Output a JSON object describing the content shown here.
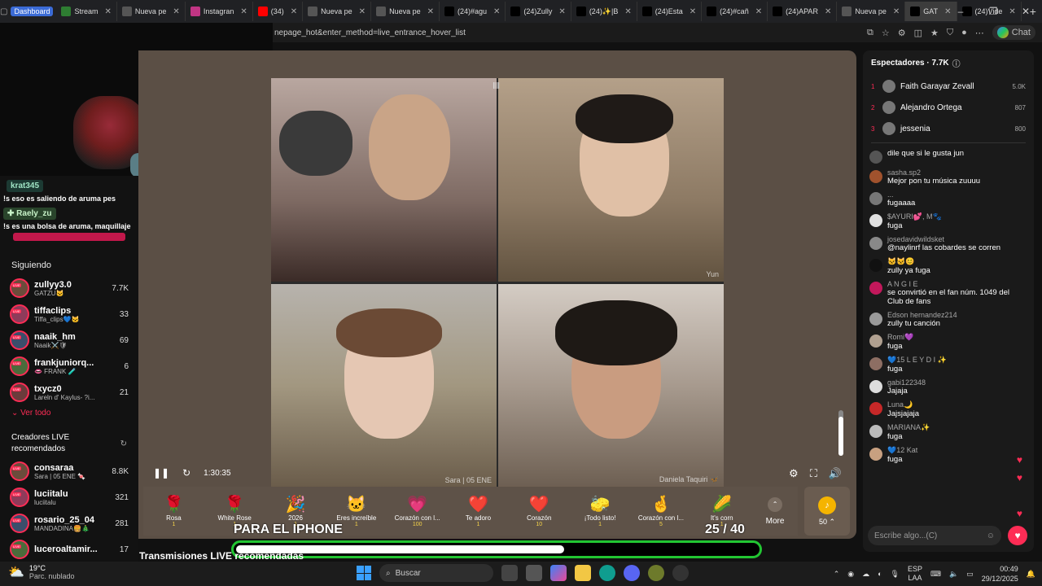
{
  "browser": {
    "tab_group": "Dashboard",
    "tabs": [
      {
        "label": "Stream",
        "color": "#2e7d32"
      },
      {
        "label": "Nueva pe",
        "color": "#555555"
      },
      {
        "label": "Instagran",
        "color": "#c13584"
      },
      {
        "label": "(34)",
        "color": "#ff0000"
      },
      {
        "label": "Nueva pe",
        "color": "#555555"
      },
      {
        "label": "Nueva pe",
        "color": "#555555"
      },
      {
        "label": "(24)#agu",
        "color": "#000000"
      },
      {
        "label": "(24)Zully",
        "color": "#000000"
      },
      {
        "label": "(24)✨|B",
        "color": "#000000"
      },
      {
        "label": "(24)Esta",
        "color": "#000000"
      },
      {
        "label": "(24)#cañ",
        "color": "#000000"
      },
      {
        "label": "(24)APAR",
        "color": "#000000"
      },
      {
        "label": "Nueva pe",
        "color": "#555555"
      },
      {
        "label": "GAT",
        "color": "#000000"
      },
      {
        "label": "(24)Vide",
        "color": "#000000"
      }
    ],
    "url": "nepage_hot&enter_method=live_entrance_hover_list",
    "chat_label": "Chat"
  },
  "overlay": {
    "user1": "krat345",
    "msg1": "!s eso es saliendo de aruma pes",
    "user2": "✚ Raely_zu",
    "msg2": "!s es una bolsa de aruma, maquillaje"
  },
  "sidebar": {
    "following_title": "Siguiendo",
    "following": [
      {
        "name": "zullyy3.0",
        "sub": "GATZU🐱",
        "count": "7.7K"
      },
      {
        "name": "tiffaclips",
        "sub": "Tiffa_clips💙🐱",
        "count": "33"
      },
      {
        "name": "naaik_hm",
        "sub": "Naaik⚔️🛡",
        "count": "69"
      },
      {
        "name": "frankjuniorq...",
        "sub": "👄 FRANK 🧪",
        "count": "6"
      },
      {
        "name": "txycz0",
        "sub": "Lareln d' Kaylus- ?i...",
        "count": "21"
      }
    ],
    "see_all": "Ver todo",
    "recommended_title": "Creadores LIVE recomendados",
    "recommended": [
      {
        "name": "consaraa",
        "sub": "Sara | 05 ENE 🍬",
        "count": "8.8K"
      },
      {
        "name": "luciitalu",
        "sub": "luciitalu",
        "count": "321"
      },
      {
        "name": "rosario_25_04",
        "sub": "MANDADINA🍔🎄",
        "count": "281"
      },
      {
        "name": "luceroaltamir...",
        "sub": "",
        "count": "17"
      }
    ]
  },
  "stage": {
    "time": "1:30:35",
    "cell_labels": [
      "",
      "Yun",
      "Sara | 05 ENE",
      "Daniela Taquiri 🦋"
    ],
    "volume_level": 0.85,
    "gifts": [
      {
        "icon": "🌹",
        "name": "Rosa",
        "price": "1"
      },
      {
        "icon": "🌹",
        "name": "White Rose",
        "price": "1"
      },
      {
        "icon": "🎉",
        "name": "2026",
        "price": "1"
      },
      {
        "icon": "🐱",
        "name": "Eres increíble",
        "price": "1"
      },
      {
        "icon": "💗",
        "name": "Corazón con l...",
        "price": "100"
      },
      {
        "icon": "❤️",
        "name": "Te adoro",
        "price": "1"
      },
      {
        "icon": "❤️",
        "name": "Corazón",
        "price": "10"
      },
      {
        "icon": "🧽",
        "name": "¡Todo listo!",
        "price": "1"
      },
      {
        "icon": "🤞",
        "name": "Corazón con l...",
        "price": "5"
      },
      {
        "icon": "🌽",
        "name": "It's corn",
        "price": "1"
      }
    ],
    "more_label": "More",
    "coin_amount": "50 ⌃"
  },
  "caption": "PARA EL IPHONE",
  "counter": "25 / 40",
  "progress": 0.63,
  "bottom_title": "Transmisiones LIVE recomendadas",
  "viewers": {
    "title": "Espectadores · 7.7K",
    "list": [
      {
        "rank": "1",
        "name": "Faith Garayar Zevall",
        "count": "5.0K"
      },
      {
        "rank": "2",
        "name": "Alejandro Ortega",
        "count": "807"
      },
      {
        "rank": "3",
        "name": "jessenia",
        "count": "800"
      }
    ]
  },
  "chat": [
    {
      "user": "",
      "text": "dile que si le gusta jun",
      "color": "#555555"
    },
    {
      "user": "sasha.sp2",
      "text": "Mejor pon tu música zuuuu",
      "color": "#a0522d"
    },
    {
      "user": "...",
      "text": "fugaaaa",
      "color": "#777777"
    },
    {
      "user": "$AYURI💕, M🐾",
      "text": "fuga",
      "color": "#e0e0e0"
    },
    {
      "user": "josedavidwildsket",
      "text": "@naylinrf las cobardes se corren",
      "color": "#888888"
    },
    {
      "user": "🐱🐱😊",
      "text": "zully ya fuga",
      "color": "#111111"
    },
    {
      "user": "A N G I E",
      "text": "se convirtió en el fan núm. 1049 del Club de fans",
      "color": "#c2185b"
    },
    {
      "user": "Edson hernandez214",
      "text": "zully tu canción",
      "color": "#999999"
    },
    {
      "user": "Romi💜",
      "text": "fuga",
      "color": "#b0a090"
    },
    {
      "user": "💙15 L E Y D I ✨",
      "text": "fuga",
      "color": "#8d6e63"
    },
    {
      "user": "gabi122348",
      "text": "Jajaja",
      "color": "#dddddd"
    },
    {
      "user": "Luna🌙",
      "text": "Jajsjajaja",
      "color": "#c62828"
    },
    {
      "user": "MARIANA✨",
      "text": "fuga",
      "color": "#bbbbbb"
    },
    {
      "user": "💙12 Kat",
      "text": "fuga",
      "color": "#c8a080"
    }
  ],
  "chat_placeholder": "Escribe algo...(C)",
  "taskbar": {
    "temp": "19°C",
    "weather": "Parc. nublado",
    "search": "Buscar",
    "lang": "ESP",
    "lang2": "LAA",
    "time": "00:49",
    "date": "29/12/2025"
  }
}
